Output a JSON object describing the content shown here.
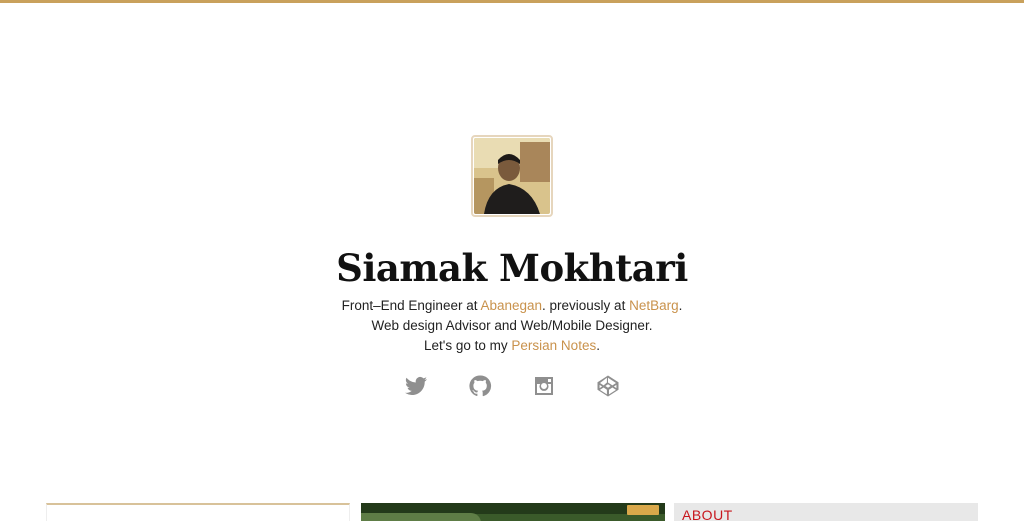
{
  "profile": {
    "name": "Siamak Mokhtari",
    "avatar_icon": "profile-photo"
  },
  "bio": {
    "line1_prefix": "Front–End Engineer at ",
    "line1_link1": "Abanegan",
    "line1_middle": ". previously at ",
    "line1_link2": "NetBarg",
    "line1_suffix": ".",
    "line2": "Web design Advisor and Web/Mobile Designer.",
    "line3_prefix": "Let's go to my ",
    "line3_link": "Persian Notes",
    "line3_suffix": "."
  },
  "social": [
    {
      "icon": "twitter-icon"
    },
    {
      "icon": "github-icon"
    },
    {
      "icon": "instagram-icon"
    },
    {
      "icon": "codepen-icon"
    }
  ],
  "colors": {
    "accent": "#c9a15c",
    "link": "#c9924c",
    "icon": "#8f8f8f"
  },
  "cards": [
    {
      "name": "project-card-1"
    },
    {
      "name": "project-card-2"
    },
    {
      "name": "project-card-3",
      "title": "ABOUT"
    }
  ]
}
